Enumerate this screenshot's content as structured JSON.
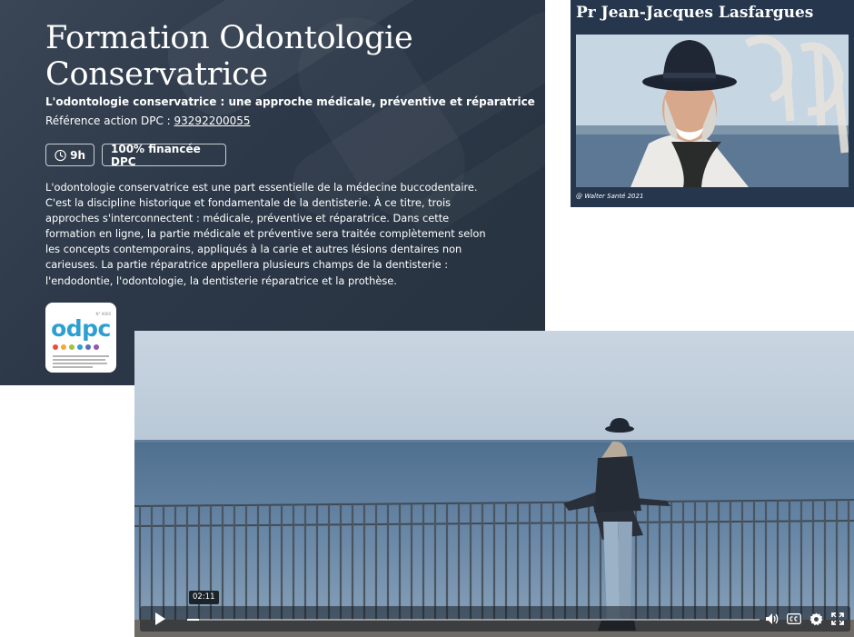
{
  "course": {
    "title": "Formation Odontologie Conservatrice",
    "subtitle": "L'odontologie conservatrice : une approche médicale, préventive et réparatrice",
    "reference_label": "Référence action DPC : ",
    "reference_number": "93292200055",
    "duration": "9h",
    "funding": "100% financée DPC",
    "description": "L'odontologie conservatrice est une part essentielle de la médecine buccodentaire. C'est la discipline historique et fondamentale de la dentisterie. À ce titre, trois approches s'interconnectent : médicale, préventive et réparatrice. Dans cette formation en ligne, la partie médicale et préventive sera traitée complètement selon les concepts contemporains, appliqués à la carie et autres lésions dentaires non carieuses. La partie réparatrice appellera plusieurs champs de la dentisterie : l'endodontie, l'odontologie, la dentisterie réparatrice et la prothèse.",
    "logo": {
      "text": "odpc",
      "icon": "odpc-logo",
      "dot_colors": [
        "#e94e3c",
        "#f4a93a",
        "#9bc53d",
        "#2e9fd1",
        "#5a6fb0",
        "#8f5aa8"
      ]
    }
  },
  "instructor": {
    "name": "Pr Jean-Jacques Lasfargues",
    "photo_credit": "@ Walter Santé 2021"
  },
  "video": {
    "current_time": "02:11",
    "progress": 0.02,
    "icons": {
      "play": "play-icon",
      "volume": "volume-icon",
      "captions": "closed-captions-icon",
      "settings": "gear-icon",
      "fullscreen": "fullscreen-icon"
    }
  },
  "colors": {
    "course_bg": "#2c3848",
    "instructor_bg": "#25364d",
    "accent": "#2e9fd1"
  }
}
